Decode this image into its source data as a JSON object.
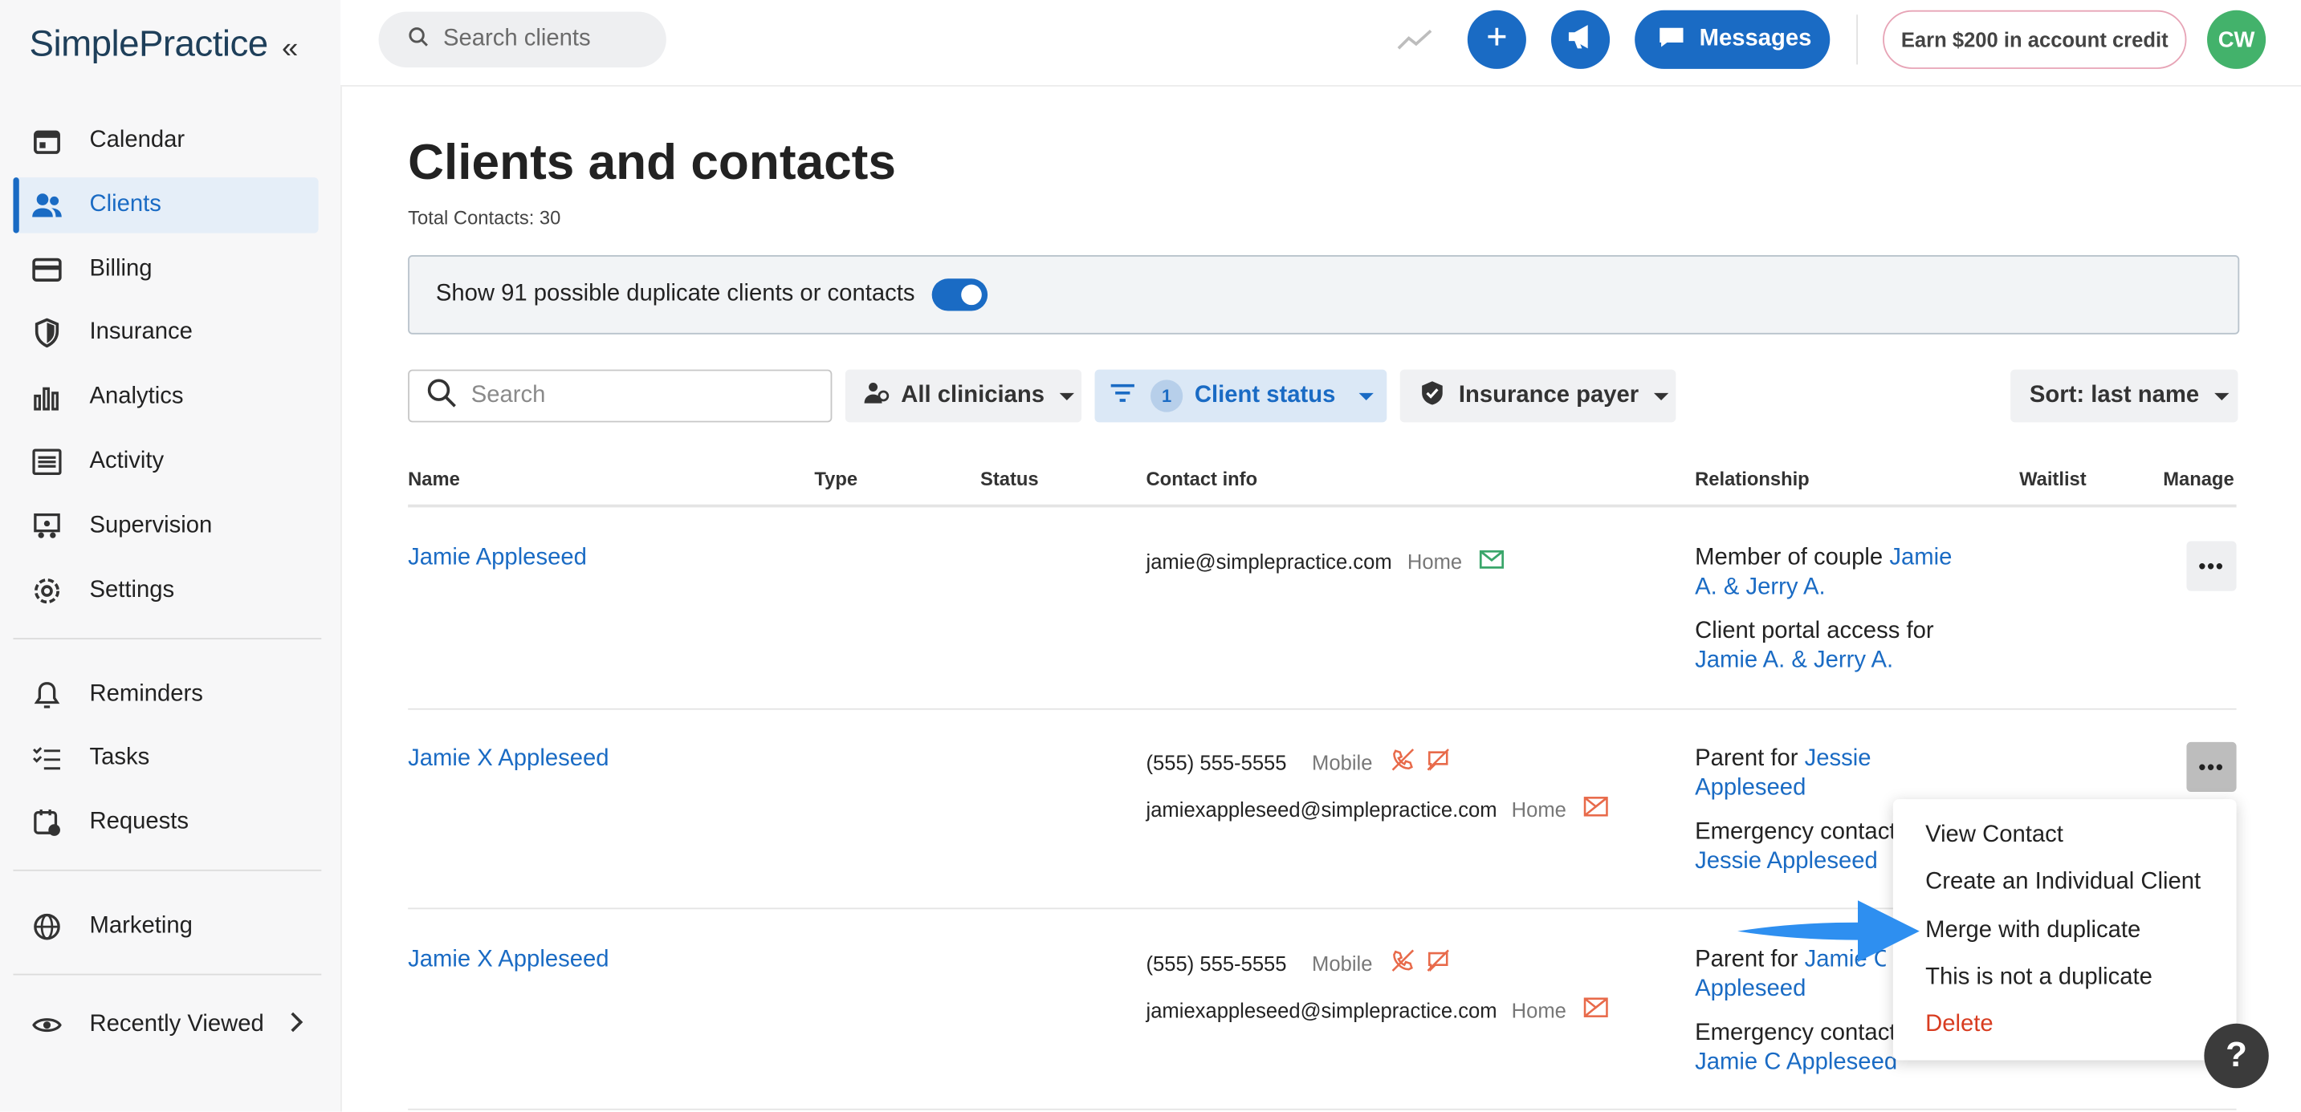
{
  "app": {
    "logo": "SimplePractice"
  },
  "sidebar": {
    "items": [
      {
        "label": "Calendar",
        "icon": "calendar-icon"
      },
      {
        "label": "Clients",
        "icon": "clients-icon",
        "active": true
      },
      {
        "label": "Billing",
        "icon": "billing-icon"
      },
      {
        "label": "Insurance",
        "icon": "shield-icon"
      },
      {
        "label": "Analytics",
        "icon": "bar-chart-icon"
      },
      {
        "label": "Activity",
        "icon": "activity-list-icon"
      },
      {
        "label": "Supervision",
        "icon": "supervision-icon"
      },
      {
        "label": "Settings",
        "icon": "gear-icon"
      },
      {
        "label": "Reminders",
        "icon": "bell-icon"
      },
      {
        "label": "Tasks",
        "icon": "tasks-icon"
      },
      {
        "label": "Requests",
        "icon": "requests-icon"
      },
      {
        "label": "Marketing",
        "icon": "globe-icon"
      },
      {
        "label": "Recently Viewed",
        "icon": "eye-icon"
      }
    ]
  },
  "topbar": {
    "search_placeholder": "Search clients",
    "messages_label": "Messages",
    "earn_label": "Earn $200 in account credit",
    "avatar_initials": "CW"
  },
  "page": {
    "title": "Clients and contacts",
    "total": "Total Contacts: 30",
    "duplicate_toggle_label": "Show 91 possible duplicate clients or contacts",
    "duplicate_toggle_on": true
  },
  "filters": {
    "search_placeholder": "Search",
    "clinicians": "All clinicians",
    "status_count": "1",
    "status": "Client status",
    "payer": "Insurance payer",
    "sort": "Sort: last name"
  },
  "table": {
    "headers": {
      "name": "Name",
      "type": "Type",
      "status": "Status",
      "contact": "Contact info",
      "relationship": "Relationship",
      "waitlist": "Waitlist",
      "manage": "Manage"
    },
    "rows": [
      {
        "name": "Jamie Appleseed",
        "contacts": [
          {
            "value": "jamie@simplepractice.com",
            "kind": "Home"
          }
        ],
        "rel1_text": "Member of couple ",
        "rel1_link": "Jamie A. & Jerry A.",
        "rel2_text": "Client portal access for ",
        "rel2_link": "Jamie A. & Jerry A."
      },
      {
        "name": "Jamie X Appleseed",
        "contacts": [
          {
            "value": "(555) 555-5555",
            "kind": "Mobile"
          },
          {
            "value": "jamiexappleseed@simplepractice.com",
            "kind": "Home"
          }
        ],
        "rel1_text": "Parent for ",
        "rel1_link": "Jessie Appleseed",
        "rel2_text": "Emergency contact",
        "rel2_link": "Jessie Appleseed"
      },
      {
        "name": "Jamie X Appleseed",
        "contacts": [
          {
            "value": "(555) 555-5555",
            "kind": "Mobile"
          },
          {
            "value": "jamiexappleseed@simplepractice.com",
            "kind": "Home"
          }
        ],
        "rel1_text": "Parent for ",
        "rel1_link": "Jamie C Appleseed",
        "rel2_text": "Emergency contact",
        "rel2_link": "Jamie C Appleseed"
      }
    ]
  },
  "manage_menu": {
    "items": [
      "View Contact",
      "Create an Individual Client",
      "Merge with duplicate",
      "This is not a duplicate",
      "Delete"
    ]
  },
  "help": {
    "label": "?"
  },
  "colors": {
    "primary": "#1a6bc4",
    "danger": "#d83c20",
    "avatar": "#43b26b",
    "annotation_arrow": "#2e8ff0"
  }
}
